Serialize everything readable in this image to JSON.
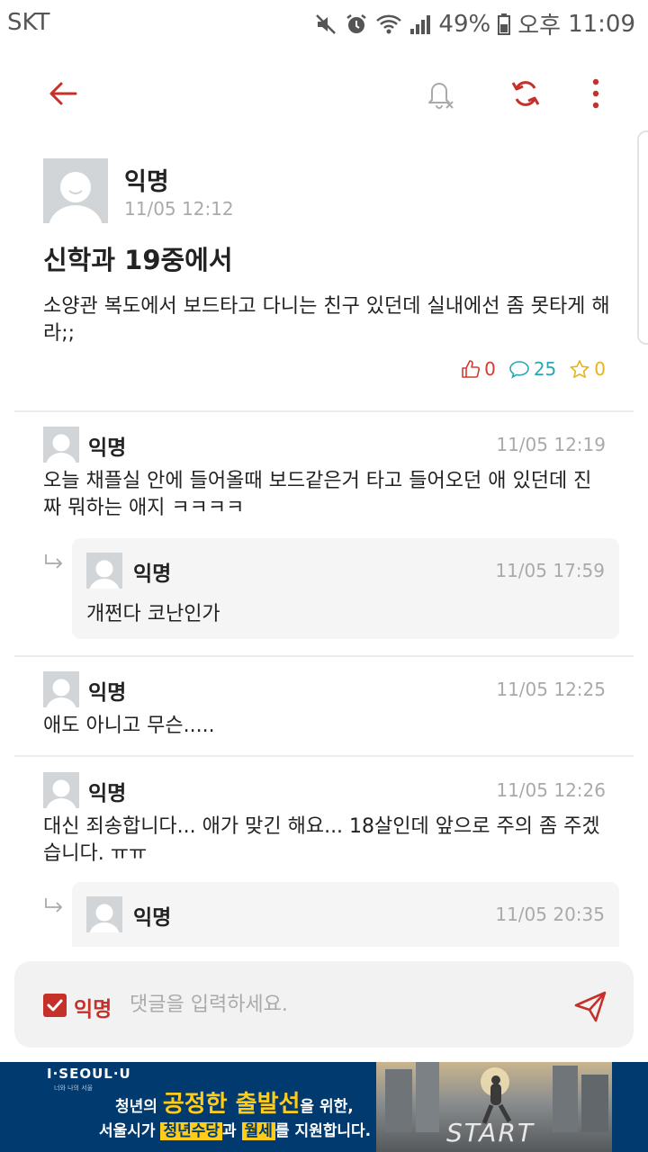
{
  "status_bar": {
    "carrier": "SKT",
    "battery": "49%",
    "ampm": "오후",
    "clock": "11:09"
  },
  "post": {
    "author": "익명",
    "time": "11/05 12:12",
    "title": "신학과 19중에서",
    "body": "소양관 복도에서 보드타고 다니는 친구 있던데 실내에선 좀 못타게 해라;;",
    "likes": "0",
    "comments": "25",
    "scraps": "0"
  },
  "comments": [
    {
      "author": "익명",
      "time": "11/05 12:19",
      "text": "오늘 채플실 안에 들어올때 보드같은거 타고 들어오던 애 있던데 진짜 뭐하는 애지 ㅋㅋㅋㅋ",
      "reply": {
        "author": "익명",
        "time": "11/05 17:59",
        "text": "개쩐다 코난인가"
      }
    },
    {
      "author": "익명",
      "time": "11/05 12:25",
      "text": "애도 아니고 무슨....."
    },
    {
      "author": "익명",
      "time": "11/05 12:26",
      "text": "대신 죄송합니다... 애가 맞긴 해요... 18살인데 앞으로 주의 좀 주겠습니다. ㅠㅠ",
      "reply": {
        "author": "익명",
        "time": "11/05 20:35"
      }
    }
  ],
  "composer": {
    "anonymous_label": "익명",
    "placeholder": "댓글을 입력하세요."
  },
  "banner": {
    "brand": "I·SEOUL·U",
    "brand_sub": "너와 나의 서울",
    "line1_a": "청년의 ",
    "line1_b": "공정한 출발선",
    "line1_c": "을 위한,",
    "line2_a": "서울시가 ",
    "line2_b": "청년수당",
    "line2_c": "과 ",
    "line2_d": "월세",
    "line2_e": "를 지원합니다.",
    "photo_text": "START"
  },
  "colors": {
    "accent": "#c6302a",
    "like": "#d33c30",
    "comment": "#2aa7b4",
    "scrap": "#e6b318"
  },
  "icons": {
    "toolbar": [
      "back-arrow-icon",
      "notification-off-icon",
      "refresh-icon",
      "more-vert-icon"
    ],
    "stats": [
      "thumb-up-icon",
      "comment-bubble-icon",
      "star-icon"
    ],
    "composer": [
      "checkbox-icon",
      "send-icon"
    ]
  }
}
